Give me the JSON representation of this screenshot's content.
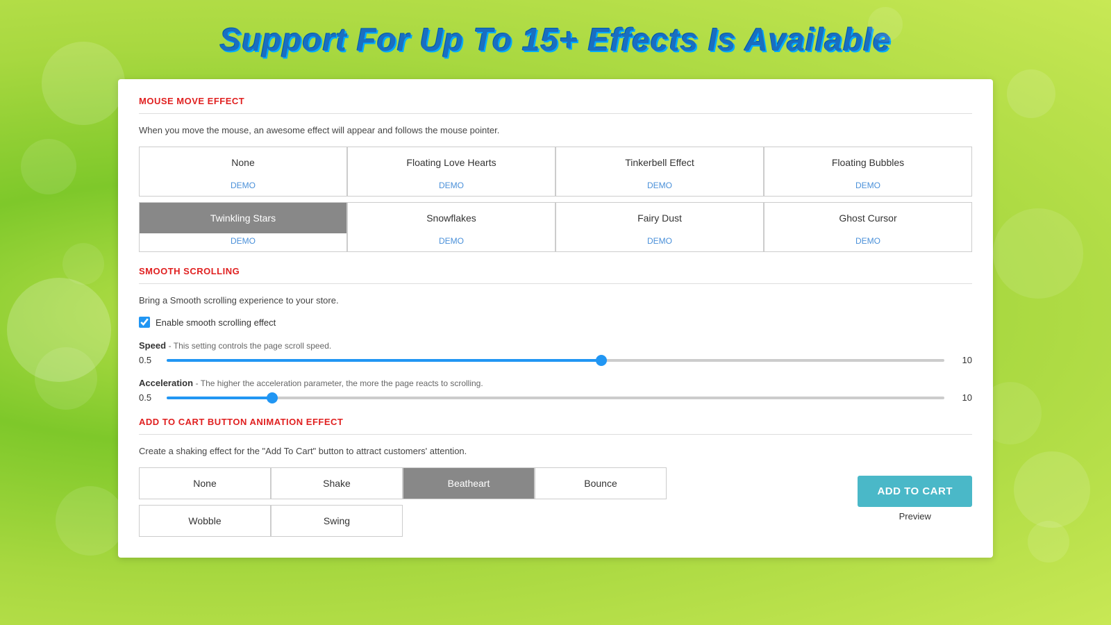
{
  "header": {
    "title": "Support For Up To 15+ Effects Is Available"
  },
  "mouse_section": {
    "label": "MOUSE MOVE EFFECT",
    "description": "When you move the mouse, an awesome effect will appear and follows the mouse pointer.",
    "effects_row1": [
      {
        "id": "none",
        "label": "None",
        "active": false,
        "demo": "DEMO"
      },
      {
        "id": "floating-love-hearts",
        "label": "Floating Love Hearts",
        "active": false,
        "demo": "DEMO"
      },
      {
        "id": "tinkerbell-effect",
        "label": "Tinkerbell Effect",
        "active": false,
        "demo": "DEMO"
      },
      {
        "id": "floating-bubbles",
        "label": "Floating Bubbles",
        "active": false,
        "demo": "DEMO"
      }
    ],
    "effects_row2": [
      {
        "id": "twinkling-stars",
        "label": "Twinkling Stars",
        "active": true,
        "demo": "DEMO"
      },
      {
        "id": "snowflakes",
        "label": "Snowflakes",
        "active": false,
        "demo": "DEMO"
      },
      {
        "id": "fairy-dust",
        "label": "Fairy Dust",
        "active": false,
        "demo": "DEMO"
      },
      {
        "id": "ghost-cursor",
        "label": "Ghost Cursor",
        "active": false,
        "demo": "DEMO"
      }
    ]
  },
  "smooth_section": {
    "label": "SMOOTH SCROLLING",
    "description": "Bring a Smooth scrolling experience to your store.",
    "checkbox_label": "Enable smooth scrolling effect",
    "checkbox_checked": true,
    "speed": {
      "label": "Speed",
      "description": "This setting controls the page scroll speed.",
      "min": "0.5",
      "max": "10",
      "value": 56
    },
    "acceleration": {
      "label": "Acceleration",
      "description": "The higher the acceleration parameter, the more the page reacts to scrolling.",
      "min": "0.5",
      "max": "10",
      "value": 13
    }
  },
  "cart_section": {
    "label": "ADD TO CART BUTTON ANIMATION EFFECT",
    "description": "Create a shaking effect for the \"Add To Cart\" button to attract customers' attention.",
    "effects_row1": [
      {
        "id": "none",
        "label": "None",
        "active": false
      },
      {
        "id": "shake",
        "label": "Shake",
        "active": false
      },
      {
        "id": "beatheart",
        "label": "Beatheart",
        "active": true
      },
      {
        "id": "bounce",
        "label": "Bounce",
        "active": false
      }
    ],
    "effects_row2": [
      {
        "id": "wobble",
        "label": "Wobble",
        "active": false
      },
      {
        "id": "swing",
        "label": "Swing",
        "active": false
      }
    ],
    "add_to_cart_label": "ADD TO CART",
    "preview_label": "Preview"
  }
}
